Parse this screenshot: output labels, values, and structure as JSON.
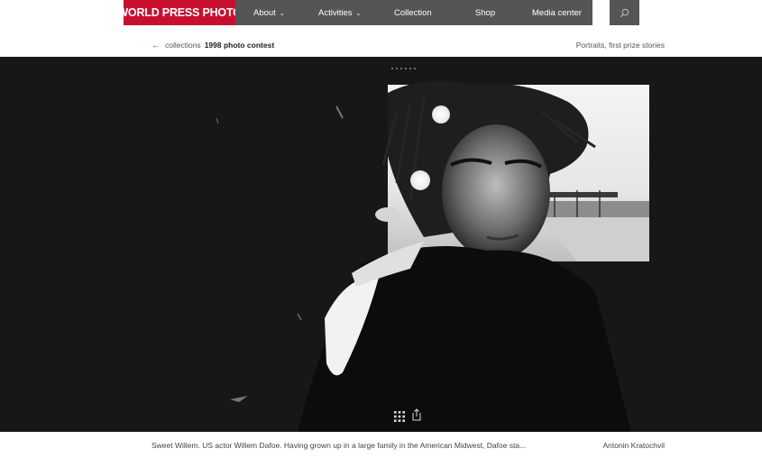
{
  "header": {
    "logo_text": "WORLD PRESS PHOTO",
    "nav": [
      {
        "label": "About",
        "has_dropdown": true
      },
      {
        "label": "Activities",
        "has_dropdown": true
      },
      {
        "label": "Collection",
        "has_dropdown": false
      },
      {
        "label": "Shop",
        "has_dropdown": false
      },
      {
        "label": "Media center",
        "has_dropdown": false
      }
    ],
    "chevron_glyph": "⌄",
    "search_icon": "search-icon"
  },
  "breadcrumb": {
    "back_icon": "arrow-left-icon",
    "collections_label": "collections",
    "contest_label": "1998 photo contest",
    "category_label": "Portraits, first prize stories"
  },
  "viewer": {
    "slide_count": 6,
    "grid_icon": "grid-icon",
    "share_icon": "share-icon"
  },
  "caption": {
    "text": "Sweet Willem. US actor Willem Dafoe. Having grown up in a large family in the American Midwest, Dafoe sta...",
    "author": "Antonin Kratochvil"
  },
  "colors": {
    "brand_red": "#c8102e",
    "nav_gray": "#555555",
    "stage_black": "#171717"
  }
}
